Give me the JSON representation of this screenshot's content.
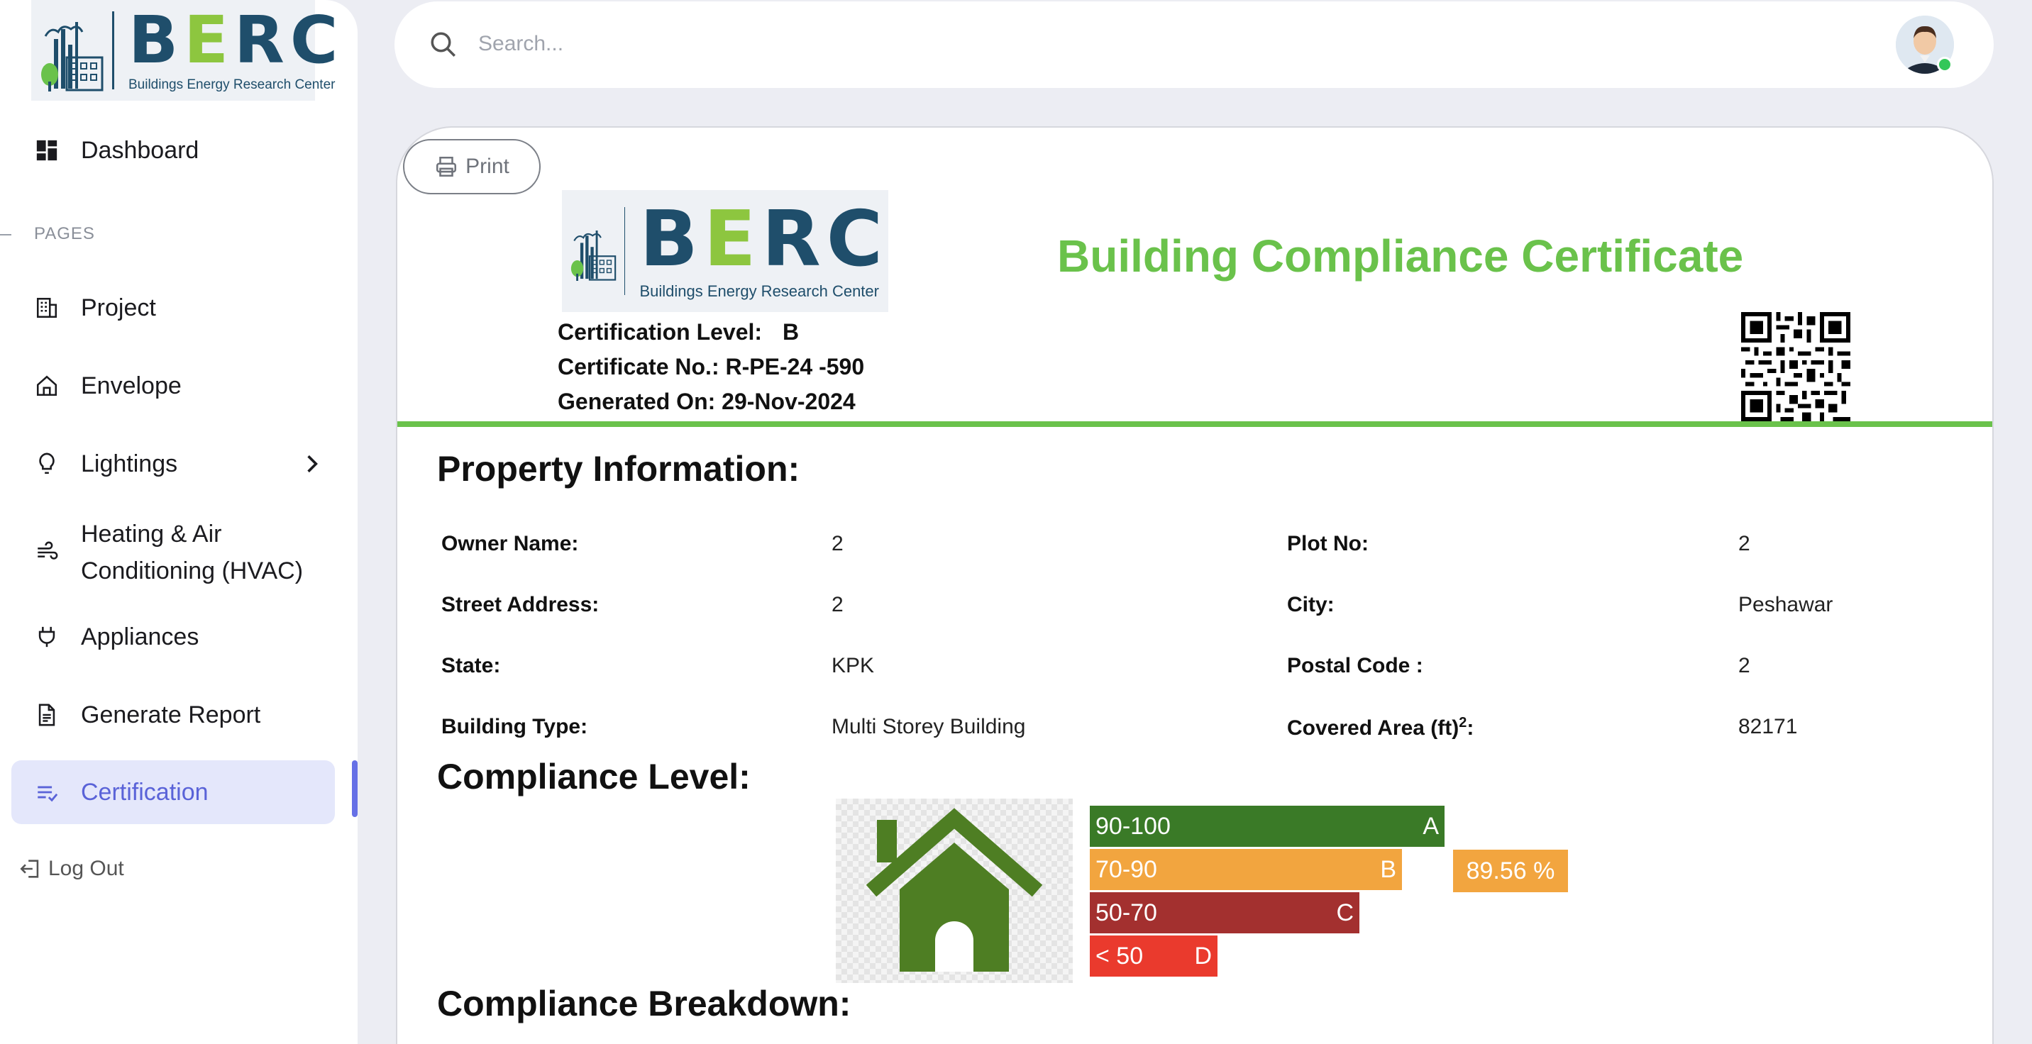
{
  "sidebar": {
    "logo": {
      "word": "BERC",
      "subtitle": "Buildings Energy Research Center"
    },
    "dashboard_label": "Dashboard",
    "pages_heading": "PAGES",
    "items": [
      {
        "label": "Project",
        "icon": "building-icon"
      },
      {
        "label": "Envelope",
        "icon": "home-icon"
      },
      {
        "label": "Lightings",
        "icon": "lightbulb-icon"
      },
      {
        "label": "Heating & Air Conditioning (HVAC)",
        "icon": "wind-icon"
      },
      {
        "label": "Appliances",
        "icon": "plug-icon"
      },
      {
        "label": "Generate Report",
        "icon": "document-icon"
      },
      {
        "label": "Certification",
        "icon": "checklist-icon",
        "active": true
      }
    ],
    "logout_label": "Log Out"
  },
  "topbar": {
    "search_placeholder": "Search..."
  },
  "certificate": {
    "print_label": "Print",
    "title": "Building Compliance Certificate",
    "level_label": "Certification Level:",
    "level_value": "B",
    "number_label": "Certificate No.:",
    "number_value": "R-PE-24 -590",
    "generated_label": "Generated On:",
    "generated_value": "29-Nov-2024",
    "property_heading": "Property Information:",
    "property": {
      "owner_label": "Owner Name:",
      "owner_value": "2",
      "plot_label": "Plot No:",
      "plot_value": "2",
      "street_label": "Street Address:",
      "street_value": "2",
      "city_label": "City:",
      "city_value": "Peshawar",
      "state_label": "State:",
      "state_value": "KPK",
      "postal_label": "Postal Code :",
      "postal_value": "2",
      "type_label": "Building Type:",
      "type_value": "Multi Storey Building",
      "area_label": "Covered Area (ft)",
      "area_sup": "2",
      "area_colon": ":",
      "area_value": "82171"
    },
    "compliance_heading": "Compliance Level:",
    "bands": [
      {
        "range": "90-100",
        "grade": "A",
        "color": "#3a7a27"
      },
      {
        "range": "70-90",
        "grade": "B",
        "color": "#f2a53f"
      },
      {
        "range": "50-70",
        "grade": "C",
        "color": "#a3302f"
      },
      {
        "range": "< 50",
        "grade": "D",
        "color": "#ea3a2d"
      }
    ],
    "score": "89.56 %",
    "breakdown_heading": "Compliance Breakdown:"
  },
  "colors": {
    "accent": "#6670e6",
    "certificate_green": "#6ac24b",
    "logo_blue": "#1f4e6b"
  }
}
